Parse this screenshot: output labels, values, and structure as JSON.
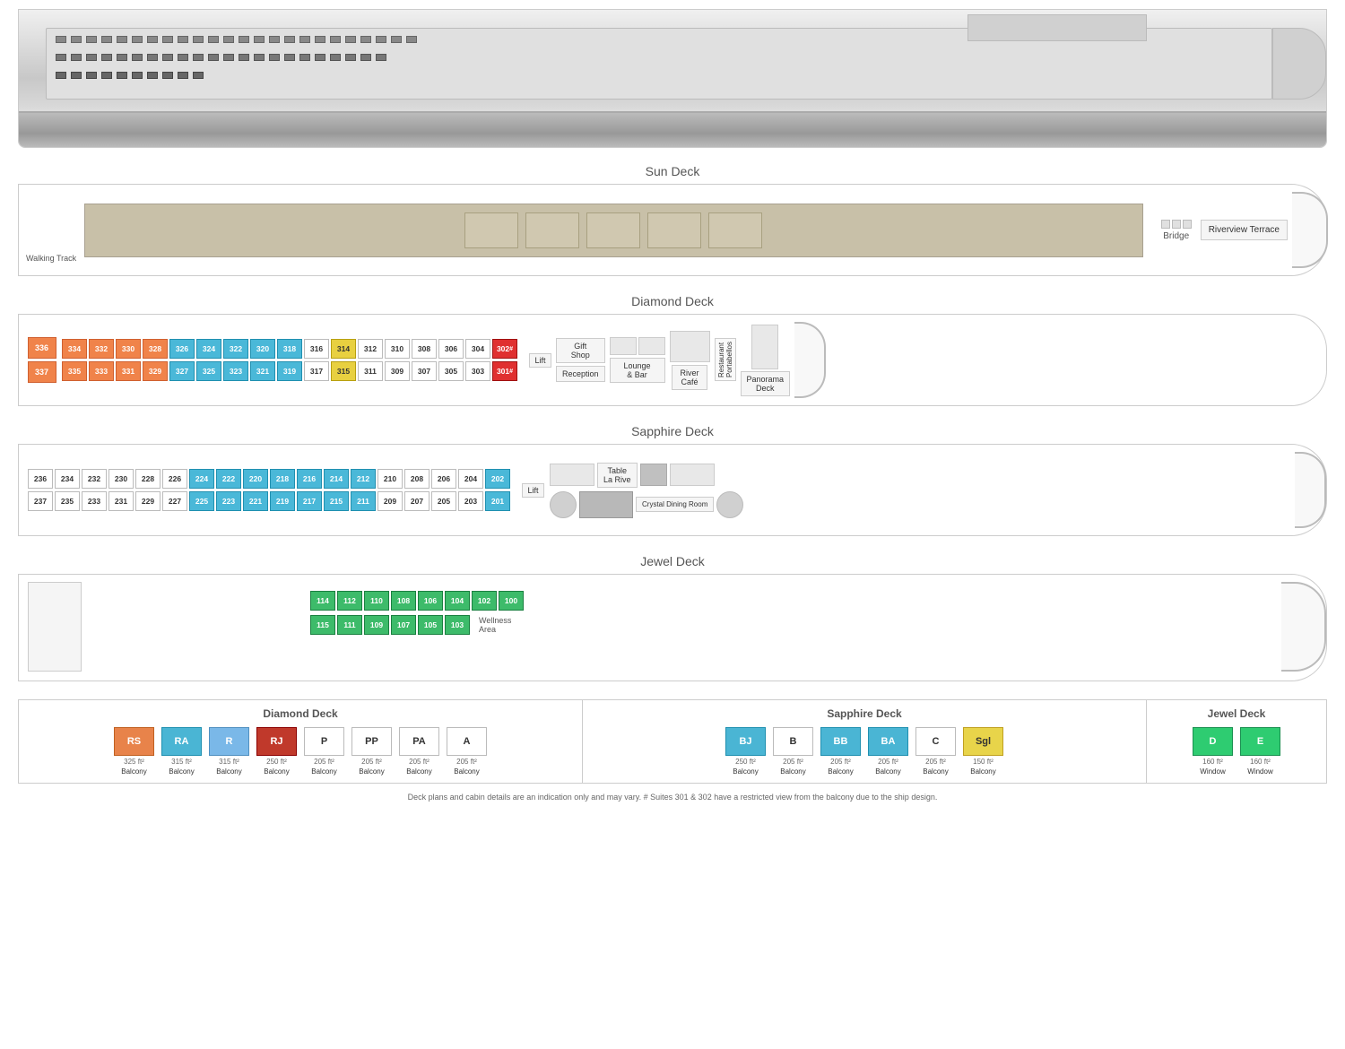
{
  "ship": {
    "image_alt": "River cruise ship"
  },
  "decks": {
    "sun": {
      "title": "Sun Deck",
      "labels": [
        "Walking Track",
        "Bridge",
        "Riverview Terrace"
      ]
    },
    "diamond": {
      "title": "Diamond Deck",
      "top_row": [
        "336",
        "334",
        "332",
        "330",
        "328",
        "326",
        "324",
        "322",
        "320",
        "318",
        "316",
        "314",
        "312",
        "310",
        "308",
        "306",
        "304",
        "302"
      ],
      "bottom_row": [
        "337",
        "335",
        "333",
        "331",
        "329",
        "327",
        "325",
        "323",
        "321",
        "319",
        "317",
        "315",
        "311",
        "309",
        "307",
        "305",
        "303",
        "301"
      ],
      "facilities": [
        "Lift",
        "Gift Shop",
        "Lounge & Bar",
        "River Café",
        "Portabellos Restaurant",
        "Panorama Deck"
      ]
    },
    "sapphire": {
      "title": "Sapphire Deck",
      "top_row": [
        "236",
        "234",
        "232",
        "230",
        "228",
        "226",
        "224",
        "222",
        "220",
        "218",
        "216",
        "214",
        "212",
        "210",
        "208",
        "206",
        "204",
        "202"
      ],
      "bottom_row": [
        "237",
        "235",
        "233",
        "231",
        "229",
        "227",
        "225",
        "223",
        "221",
        "219",
        "217",
        "215",
        "211",
        "209",
        "207",
        "205",
        "203",
        "201"
      ],
      "facilities": [
        "Lift",
        "Table La Rive",
        "Crystal Dining Room"
      ]
    },
    "jewel": {
      "title": "Jewel Deck",
      "top_row": [
        "114",
        "112",
        "110",
        "108",
        "106",
        "104",
        "102",
        "100"
      ],
      "bottom_row": [
        "115",
        "111",
        "109",
        "107",
        "105",
        "103"
      ],
      "facilities": [
        "Wellness Area"
      ]
    }
  },
  "legend": {
    "diamond_title": "Diamond Deck",
    "sapphire_title": "Sapphire Deck",
    "jewel_title": "Jewel Deck",
    "items": [
      {
        "code": "RS",
        "size": "325 ft²",
        "type": "Balcony",
        "color": "#e8834a"
      },
      {
        "code": "RA",
        "size": "315 ft²",
        "type": "Balcony",
        "color": "#4ab5d4"
      },
      {
        "code": "R",
        "size": "315 ft²",
        "type": "Balcony",
        "color": "#7ab8e8"
      },
      {
        "code": "RJ",
        "size": "250 ft²",
        "type": "Balcony",
        "color": "#c0392b"
      },
      {
        "code": "P",
        "size": "205 ft²",
        "type": "Balcony",
        "color": "#ffffff"
      },
      {
        "code": "PP",
        "size": "205 ft²",
        "type": "Balcony",
        "color": "#ffffff"
      },
      {
        "code": "PA",
        "size": "205 ft²",
        "type": "Balcony",
        "color": "#ffffff"
      },
      {
        "code": "A",
        "size": "205 ft²",
        "type": "Balcony",
        "color": "#ffffff"
      },
      {
        "code": "BJ",
        "size": "250 ft²",
        "type": "Balcony",
        "color": "#4ab5d4"
      },
      {
        "code": "B",
        "size": "205 ft²",
        "type": "Balcony",
        "color": "#ffffff"
      },
      {
        "code": "BB",
        "size": "205 ft²",
        "type": "Balcony",
        "color": "#4ab5d4"
      },
      {
        "code": "BA",
        "size": "205 ft²",
        "type": "Balcony",
        "color": "#4ab5d4"
      },
      {
        "code": "C",
        "size": "205 ft²",
        "type": "Balcony",
        "color": "#ffffff"
      },
      {
        "code": "Sgl",
        "size": "150 ft²",
        "type": "Balcony",
        "color": "#e8d44a"
      },
      {
        "code": "D",
        "size": "160 ft²",
        "type": "Window",
        "color": "#2ecc71"
      },
      {
        "code": "E",
        "size": "160 ft²",
        "type": "Window",
        "color": "#2ecc71"
      }
    ]
  },
  "footnote": "Deck plans and cabin details are an indication only and may vary.  # Suites 301 & 302 have a restricted view from the balcony due to the ship design."
}
